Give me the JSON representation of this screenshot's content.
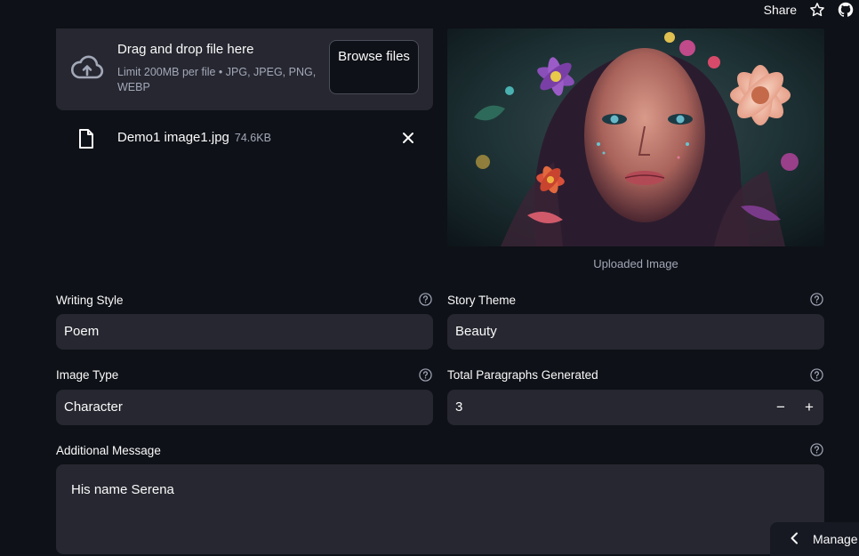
{
  "topbar": {
    "share_label": "Share",
    "icons": [
      "star-icon",
      "github-icon"
    ]
  },
  "uploader": {
    "title": "Drag and drop file here",
    "subtitle": "Limit 200MB per file • JPG, JPEG, PNG, WEBP",
    "browse_label": "Browse files",
    "file": {
      "name": "Demo1 image1.jpg",
      "size": "74.6KB"
    }
  },
  "image": {
    "caption": "Uploaded Image"
  },
  "form": {
    "writing_style": {
      "label": "Writing Style",
      "value": "Poem"
    },
    "story_theme": {
      "label": "Story Theme",
      "value": "Beauty"
    },
    "image_type": {
      "label": "Image Type",
      "value": "Character"
    },
    "total_paragraphs": {
      "label": "Total Paragraphs Generated",
      "value": "3",
      "minus": "−",
      "plus": "+"
    },
    "additional_message": {
      "label": "Additional Message",
      "value": "His name Serena"
    }
  },
  "manage_label": "Manage",
  "colors": {
    "background": "#0e1117",
    "field": "#262730",
    "text": "#fafafa",
    "muted": "#a3a8b8"
  }
}
